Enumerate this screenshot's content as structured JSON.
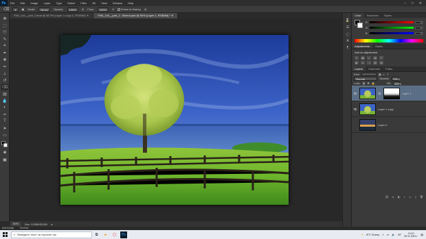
{
  "app": {
    "logo": "Ps"
  },
  "menu": [
    "File",
    "Edit",
    "Image",
    "Layer",
    "Type",
    "Select",
    "Filter",
    "3D",
    "View",
    "Window",
    "Help"
  ],
  "window_controls": [
    "–",
    "□",
    "✕"
  ],
  "options_bar": {
    "mode_label": "Mode:",
    "mode_value": "Brush",
    "opacity_label": "Opacity:",
    "opacity_value": "100%",
    "flow_label": "Flow:",
    "flow_value": "100%",
    "erase_history": "Erase to History"
  },
  "doc_tabs": [
    {
      "label": "FM4_1xh__part_Canal @ 58.3% (Layer 1 copy 2, RGB/8#) ✕",
      "active": false
    },
    {
      "label": "FM4_1xh__part_2 - Bueno.psd @ 50% (Layer 1, RGB/8#) * ✕",
      "active": true
    }
  ],
  "status": {
    "zoom": "50%",
    "doc": "Doc: 5,93M/33,9M"
  },
  "bridge_tabs": [
    "Mini Bridge",
    "Timeline"
  ],
  "color_panel": {
    "tabs": [
      "Color",
      "Swatches",
      "Styles"
    ],
    "sliders": [
      {
        "label": "R",
        "value": "0"
      },
      {
        "label": "G",
        "value": "0"
      },
      {
        "label": "B",
        "value": "0"
      }
    ]
  },
  "adjustments": {
    "tabs": [
      "Adjustments",
      "Styles"
    ],
    "title": "Add an adjustment",
    "icons": [
      "☀",
      "▦",
      "◐",
      "▤",
      "▽",
      "◧",
      "⚖",
      "◑",
      "▨",
      "▥"
    ]
  },
  "layers": {
    "tabs": [
      "Layers",
      "Channels",
      "Paths"
    ],
    "kind_label": "Kind",
    "blend_mode": "Normal",
    "opacity_label": "Opacity:",
    "opacity_value": "100%",
    "lock_label": "Lock:",
    "fill_label": "Fill:",
    "fill_value": "100%",
    "items": [
      {
        "name": "Layer 1",
        "selected": true,
        "has_mask": true
      },
      {
        "name": "Layer 1 copy",
        "selected": false,
        "has_mask": false
      },
      {
        "name": "Layer 0",
        "selected": false,
        "has_mask": false
      }
    ],
    "footer_icons": [
      "⛓",
      "fx",
      "◧",
      "◐",
      "▭",
      "▯",
      "🗑"
    ]
  },
  "taskbar": {
    "search_placeholder": "Въведете текст за търсене тук",
    "weather": "8°C  Sunny",
    "language": "БГ",
    "time": "14:10",
    "date": "25.11.2021 г."
  }
}
